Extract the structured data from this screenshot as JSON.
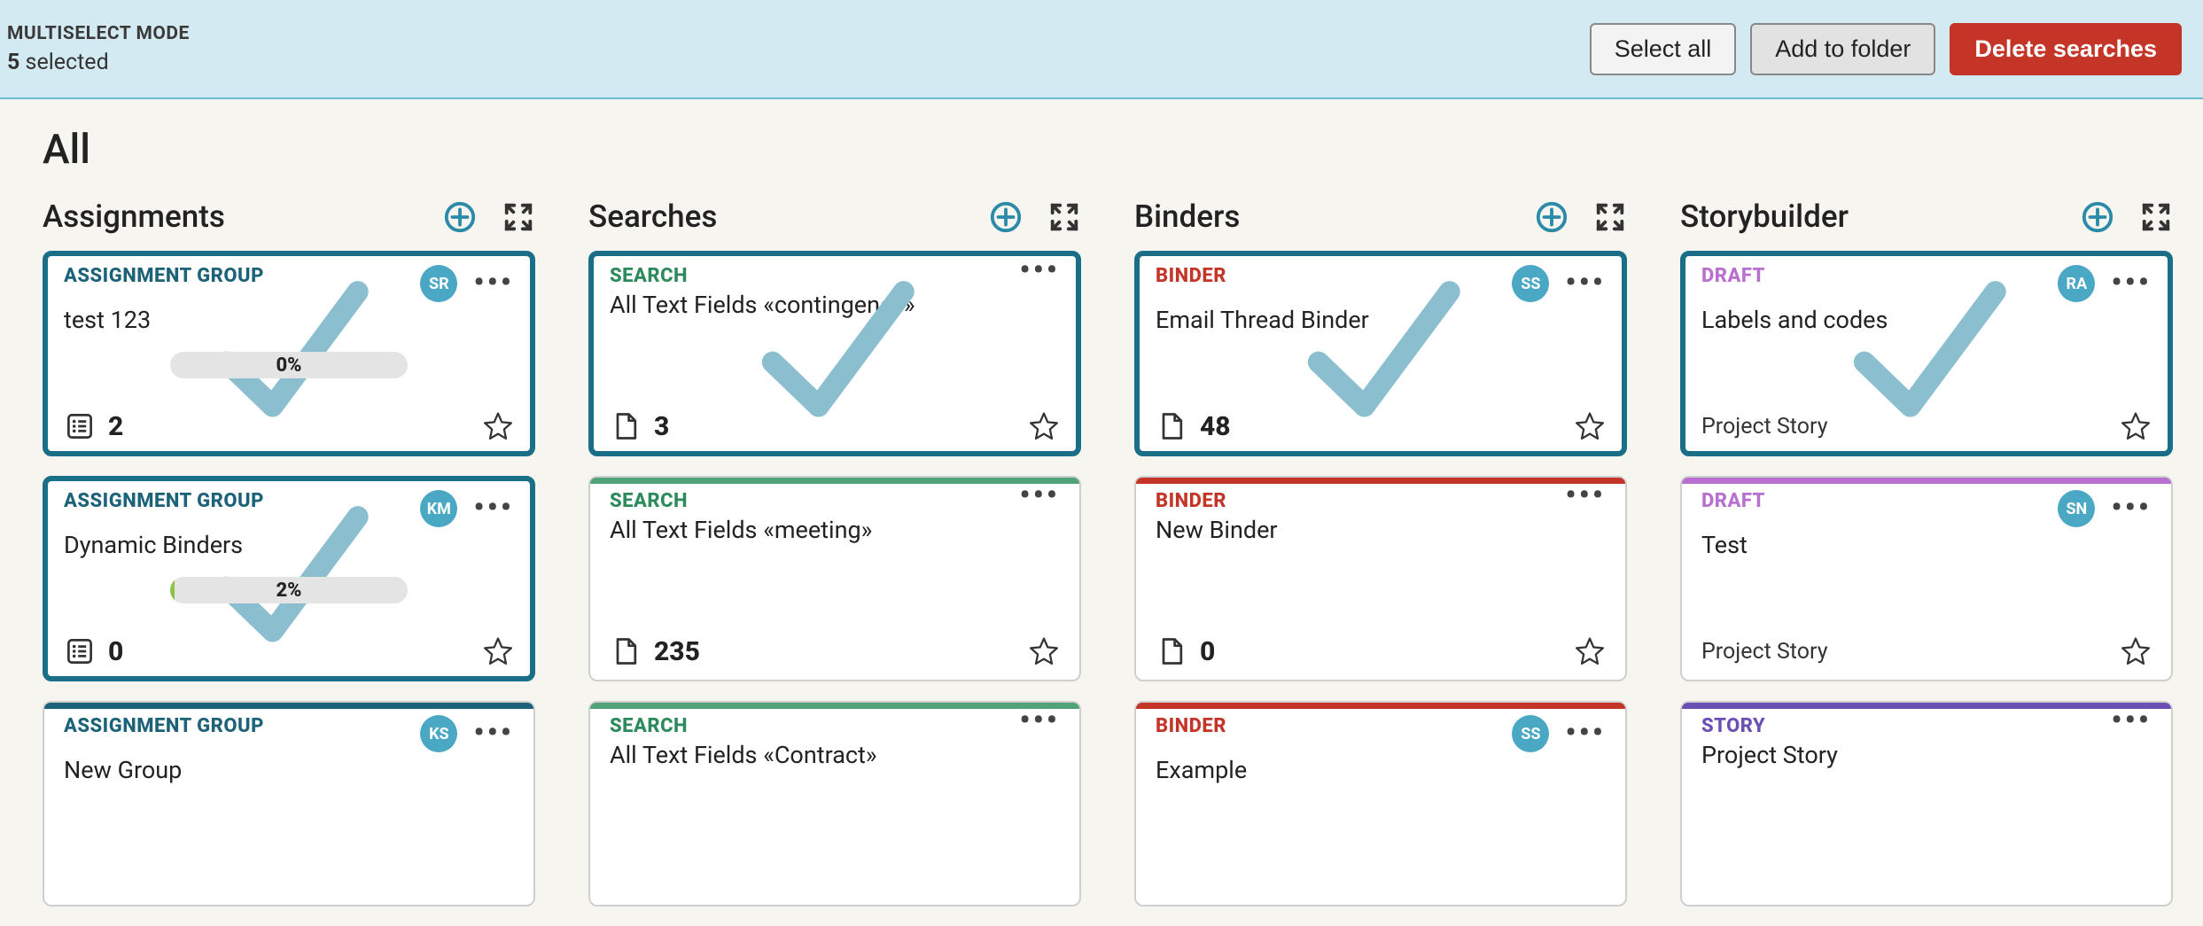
{
  "topbar": {
    "mode_label": "MULTISELECT MODE",
    "selected_count": "5",
    "selected_word": "selected",
    "select_all": "Select all",
    "add_to_folder": "Add to folder",
    "delete_searches": "Delete searches"
  },
  "page_title": "All",
  "columns": [
    {
      "title": "Assignments",
      "cards": [
        {
          "type_label": "ASSIGNMENT GROUP",
          "type_class": "type-teal",
          "stripe": "stripe-teal",
          "title": "test 123",
          "avatar": "SR",
          "selected": true,
          "progress": "0%",
          "progress_pct": 0,
          "count": "2",
          "count_icon": "list"
        },
        {
          "type_label": "ASSIGNMENT GROUP",
          "type_class": "type-teal",
          "stripe": "stripe-teal",
          "title": "Dynamic Binders",
          "avatar": "KM",
          "selected": true,
          "progress": "2%",
          "progress_pct": 2,
          "count": "0",
          "count_icon": "list"
        },
        {
          "type_label": "ASSIGNMENT GROUP",
          "type_class": "type-teal",
          "stripe": "stripe-teal",
          "title": "New Group",
          "avatar": "KS",
          "selected": false
        }
      ]
    },
    {
      "title": "Searches",
      "cards": [
        {
          "type_label": "SEARCH",
          "type_class": "type-green",
          "stripe": "stripe-green",
          "title": "All Text Fields «contingency»",
          "selected": true,
          "count": "3",
          "count_icon": "doc"
        },
        {
          "type_label": "SEARCH",
          "type_class": "type-green",
          "stripe": "stripe-green",
          "title": "All Text Fields «meeting»",
          "selected": false,
          "count": "235",
          "count_icon": "doc"
        },
        {
          "type_label": "SEARCH",
          "type_class": "type-green",
          "stripe": "stripe-green",
          "title": "All Text Fields «Contract»",
          "selected": false
        }
      ]
    },
    {
      "title": "Binders",
      "cards": [
        {
          "type_label": "BINDER",
          "type_class": "type-red",
          "stripe": "stripe-red",
          "title": "Email Thread Binder",
          "avatar": "SS",
          "selected": true,
          "count": "48",
          "count_icon": "doc"
        },
        {
          "type_label": "BINDER",
          "type_class": "type-red",
          "stripe": "stripe-red",
          "title": "New Binder",
          "selected": false,
          "count": "0",
          "count_icon": "doc"
        },
        {
          "type_label": "BINDER",
          "type_class": "type-red",
          "stripe": "stripe-red",
          "title": "Example",
          "avatar": "SS",
          "selected": false
        }
      ]
    },
    {
      "title": "Storybuilder",
      "cards": [
        {
          "type_label": "DRAFT",
          "type_class": "type-purple",
          "stripe": "stripe-purple",
          "title": "Labels and codes",
          "avatar": "RA",
          "selected": true,
          "subtitle": "Project Story"
        },
        {
          "type_label": "DRAFT",
          "type_class": "type-purple",
          "stripe": "stripe-purple",
          "title": "Test",
          "avatar": "SN",
          "selected": false,
          "subtitle": "Project Story"
        },
        {
          "type_label": "STORY",
          "type_class": "type-violet",
          "stripe": "stripe-violet",
          "title": "Project Story",
          "selected": false
        }
      ]
    }
  ]
}
